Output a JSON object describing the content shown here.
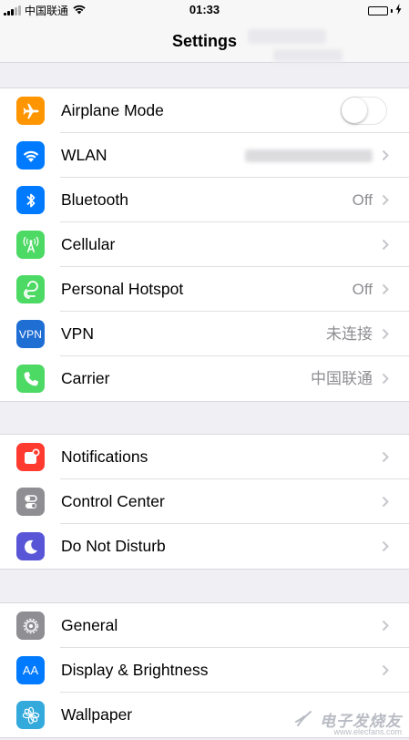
{
  "status_bar": {
    "carrier": "中国联通",
    "time": "01:33",
    "wifi_icon": "wifi-icon",
    "battery_icon": "battery-full-charging-icon",
    "battery_color": "#4cd964"
  },
  "nav": {
    "title": "Settings"
  },
  "groups": [
    {
      "rows": [
        {
          "label": "Airplane Mode",
          "icon": "airplane-icon",
          "color": "#ff9500",
          "toggle": false
        },
        {
          "label": "WLAN",
          "icon": "wifi-icon",
          "color": "#007aff"
        },
        {
          "label": "Bluetooth",
          "icon": "bluetooth-icon",
          "color": "#007aff",
          "value": "Off"
        },
        {
          "label": "Cellular",
          "icon": "cellular-antenna-icon",
          "color": "#4cd964"
        },
        {
          "label": "Personal Hotspot",
          "icon": "hotspot-icon",
          "color": "#4cd964",
          "value": "Off"
        },
        {
          "label": "VPN",
          "icon": "vpn-icon",
          "icon_text": "VPN",
          "color": "#1f6ed4",
          "value": "未连接"
        },
        {
          "label": "Carrier",
          "icon": "phone-icon",
          "color": "#4cd964",
          "value": "中国联通"
        }
      ]
    },
    {
      "rows": [
        {
          "label": "Notifications",
          "icon": "notifications-icon",
          "color": "#ff3b30"
        },
        {
          "label": "Control Center",
          "icon": "control-center-icon",
          "color": "#8e8e93"
        },
        {
          "label": "Do Not Disturb",
          "icon": "moon-icon",
          "color": "#5856d6"
        }
      ]
    },
    {
      "rows": [
        {
          "label": "General",
          "icon": "gear-icon",
          "color": "#8e8e93"
        },
        {
          "label": "Display & Brightness",
          "icon": "display-icon",
          "icon_text": "AA",
          "color": "#007aff"
        },
        {
          "label": "Wallpaper",
          "icon": "wallpaper-flower-icon",
          "color": "#34aadc"
        }
      ]
    }
  ],
  "watermark": {
    "text": "电子发烧友",
    "url": "www.elecfans.com",
    "icon": "watermark-logo-icon"
  }
}
